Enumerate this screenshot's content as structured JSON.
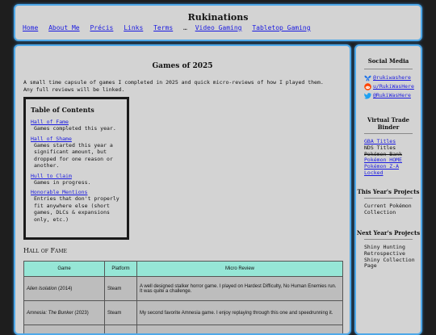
{
  "site": {
    "title": "Rukinations",
    "nav": [
      {
        "label": "Home"
      },
      {
        "label": "About Me"
      },
      {
        "label": "Précis"
      },
      {
        "label": "Links"
      },
      {
        "label": "Terms"
      },
      {
        "label": "…",
        "separator": true
      },
      {
        "label": "Video Gaming"
      },
      {
        "label": "Tabletop Gaming"
      }
    ]
  },
  "main": {
    "title": "Games of 2025",
    "intro": "A small time capsule of games I completed in 2025 and quick micro-reviews of how I played them. Any full reviews will be linked.",
    "toc": {
      "title": "Table of Contents",
      "entries": [
        {
          "link": "Hall of Fame",
          "desc": "Games completed this year."
        },
        {
          "link": "Hall of Shame",
          "desc": "Games started this year a significant amount, but dropped for one reason or another."
        },
        {
          "link": "Hull to Claim",
          "desc": "Games in progress."
        },
        {
          "link": "Honorable Mentions",
          "desc": "Entries that don't properly fit anywhere else (short games, DLCs & expansions only, etc.)"
        }
      ]
    },
    "hall_of_fame_heading": "Hall of Fame",
    "table": {
      "headers": [
        "Game",
        "Platform",
        "Micro Review"
      ],
      "rows": [
        {
          "game": "Alien Isolation",
          "year": "(2014)",
          "platform": "Steam",
          "review": "A well designed stalker horror game. I played on Hardest Difficulty, No Human Enemies run. It was quite a challenge."
        },
        {
          "game": "Amnesia: The Bunker",
          "year": "(2023)",
          "platform": "Steam",
          "review": "My second favorite Amnesia game. I enjoy replaying through this one and speedrunning it."
        },
        {
          "game": "",
          "year": "",
          "platform": "",
          "review": ""
        }
      ]
    }
  },
  "sidebar": {
    "social_heading": "Social Media",
    "social": [
      {
        "icon": "butterfly-icon",
        "label": "@rukiwashere"
      },
      {
        "icon": "reddit-icon",
        "label": "u/RukiWasHere"
      },
      {
        "icon": "twitter-bird-icon",
        "label": "@RukiWasHere"
      }
    ],
    "binder_heading": "Virtual Trade Binder",
    "binder": [
      {
        "label": "GBA Titles",
        "style": "link"
      },
      {
        "label": "NDS Titles",
        "style": "plain"
      },
      {
        "label": "Pokémon Bank",
        "style": "strike"
      },
      {
        "label": "Pokémon HOME",
        "style": "link"
      },
      {
        "label": "Pokémon Z-A",
        "style": "link"
      },
      {
        "label": "Locked",
        "style": "link"
      }
    ],
    "this_year_heading": "This Year's Projects",
    "this_year": [
      "Current Pokémon Collection"
    ],
    "next_year_heading": "Next Year's Projects",
    "next_year": [
      "Shiny Hunting Retrospective Shiny Collection Page"
    ]
  },
  "colors": {
    "panel_border": "#4fa8e8",
    "panel_bg": "#d3d3d3",
    "table_header": "#96e6d6",
    "link": "#1a1ae0"
  }
}
